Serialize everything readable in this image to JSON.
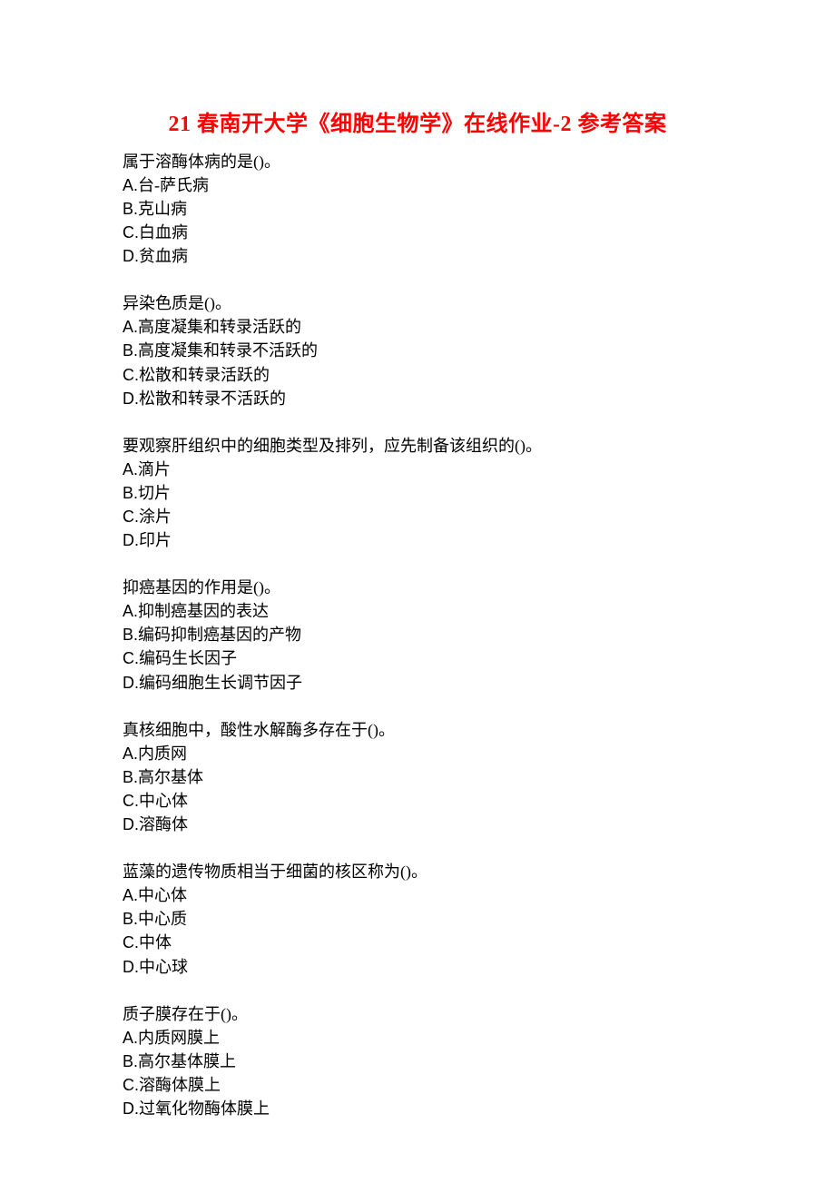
{
  "title": "21 春南开大学《细胞生物学》在线作业-2 参考答案",
  "questions": [
    {
      "stem": "属于溶酶体病的是()。",
      "options": [
        {
          "label": "A.",
          "text": "台-萨氏病"
        },
        {
          "label": "B.",
          "text": "克山病"
        },
        {
          "label": "C.",
          "text": "白血病"
        },
        {
          "label": "D.",
          "text": "贫血病"
        }
      ]
    },
    {
      "stem": "异染色质是()。",
      "options": [
        {
          "label": "A.",
          "text": "高度凝集和转录活跃的"
        },
        {
          "label": "B.",
          "text": "高度凝集和转录不活跃的"
        },
        {
          "label": "C.",
          "text": "松散和转录活跃的"
        },
        {
          "label": "D.",
          "text": "松散和转录不活跃的"
        }
      ]
    },
    {
      "stem": "要观察肝组织中的细胞类型及排列，应先制备该组织的()。",
      "options": [
        {
          "label": "A.",
          "text": "滴片"
        },
        {
          "label": "B.",
          "text": "切片"
        },
        {
          "label": "C.",
          "text": "涂片"
        },
        {
          "label": "D.",
          "text": "印片"
        }
      ]
    },
    {
      "stem": "抑癌基因的作用是()。",
      "options": [
        {
          "label": "A.",
          "text": "抑制癌基因的表达"
        },
        {
          "label": "B.",
          "text": "编码抑制癌基因的产物"
        },
        {
          "label": "C.",
          "text": "编码生长因子"
        },
        {
          "label": "D.",
          "text": "编码细胞生长调节因子"
        }
      ]
    },
    {
      "stem": "真核细胞中，酸性水解酶多存在于()。",
      "options": [
        {
          "label": "A.",
          "text": "内质网"
        },
        {
          "label": "B.",
          "text": "高尔基体"
        },
        {
          "label": "C.",
          "text": "中心体"
        },
        {
          "label": "D.",
          "text": "溶酶体"
        }
      ]
    },
    {
      "stem": "蓝藻的遗传物质相当于细菌的核区称为()。",
      "options": [
        {
          "label": "A.",
          "text": "中心体"
        },
        {
          "label": "B.",
          "text": "中心质"
        },
        {
          "label": "C.",
          "text": "中体"
        },
        {
          "label": "D.",
          "text": "中心球"
        }
      ]
    },
    {
      "stem": "质子膜存在于()。",
      "options": [
        {
          "label": "A.",
          "text": "内质网膜上"
        },
        {
          "label": "B.",
          "text": "高尔基体膜上"
        },
        {
          "label": "C.",
          "text": "溶酶体膜上"
        },
        {
          "label": "D.",
          "text": "过氧化物酶体膜上"
        }
      ]
    }
  ]
}
